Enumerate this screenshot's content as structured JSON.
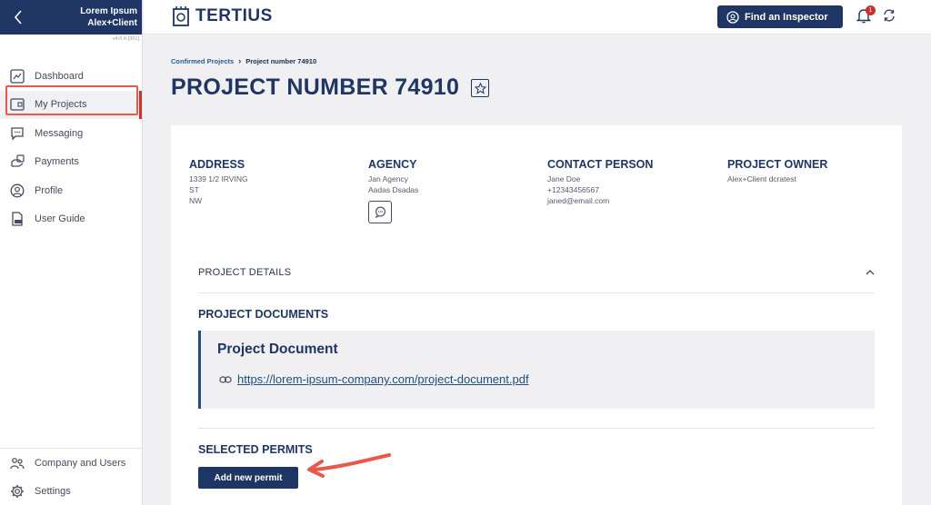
{
  "sidebar": {
    "user_name": "Lorem Ipsum",
    "user_role": "Alex+Client",
    "version": "v4-0.6-[301]",
    "items": [
      {
        "label": "Dashboard",
        "icon": "dashboard-icon"
      },
      {
        "label": "My Projects",
        "icon": "projects-icon"
      },
      {
        "label": "Messaging",
        "icon": "chat-icon"
      },
      {
        "label": "Payments",
        "icon": "payments-icon"
      },
      {
        "label": "Profile",
        "icon": "profile-icon"
      },
      {
        "label": "User Guide",
        "icon": "pdf-icon"
      }
    ],
    "bottom_items": [
      {
        "label": "Company and Users",
        "icon": "users-icon"
      },
      {
        "label": "Settings",
        "icon": "gear-icon"
      }
    ]
  },
  "topbar": {
    "logo": "TERTIUS",
    "find_button": "Find an Inspector",
    "notification_count": "1"
  },
  "breadcrumb": {
    "parent": "Confirmed Projects",
    "current": "Project number 74910"
  },
  "page_title": "PROJECT NUMBER 74910",
  "info": {
    "address": {
      "label": "ADDRESS",
      "lines": [
        "1339 1/2 IRVING",
        "ST",
        "NW"
      ]
    },
    "agency": {
      "label": "AGENCY",
      "lines": [
        "Jan Agency",
        "Aadas Dsadas"
      ]
    },
    "contact": {
      "label": "CONTACT PERSON",
      "lines": [
        "Jane Doe",
        "+12343456567",
        "janed@email.com"
      ]
    },
    "owner": {
      "label": "PROJECT OWNER",
      "lines": [
        "Alex+Client dcratest"
      ]
    }
  },
  "project_details_label": "PROJECT DETAILS",
  "documents": {
    "title": "PROJECT DOCUMENTS",
    "doc_title": "Project Document",
    "doc_url": "https://lorem-ipsum-company.com/project-document.pdf"
  },
  "permits": {
    "title": "SELECTED PERMITS",
    "add_button": "Add new permit"
  },
  "colors": {
    "navy": "#1f3563",
    "highlight": "#e8584b",
    "badge": "#c82f2f"
  }
}
